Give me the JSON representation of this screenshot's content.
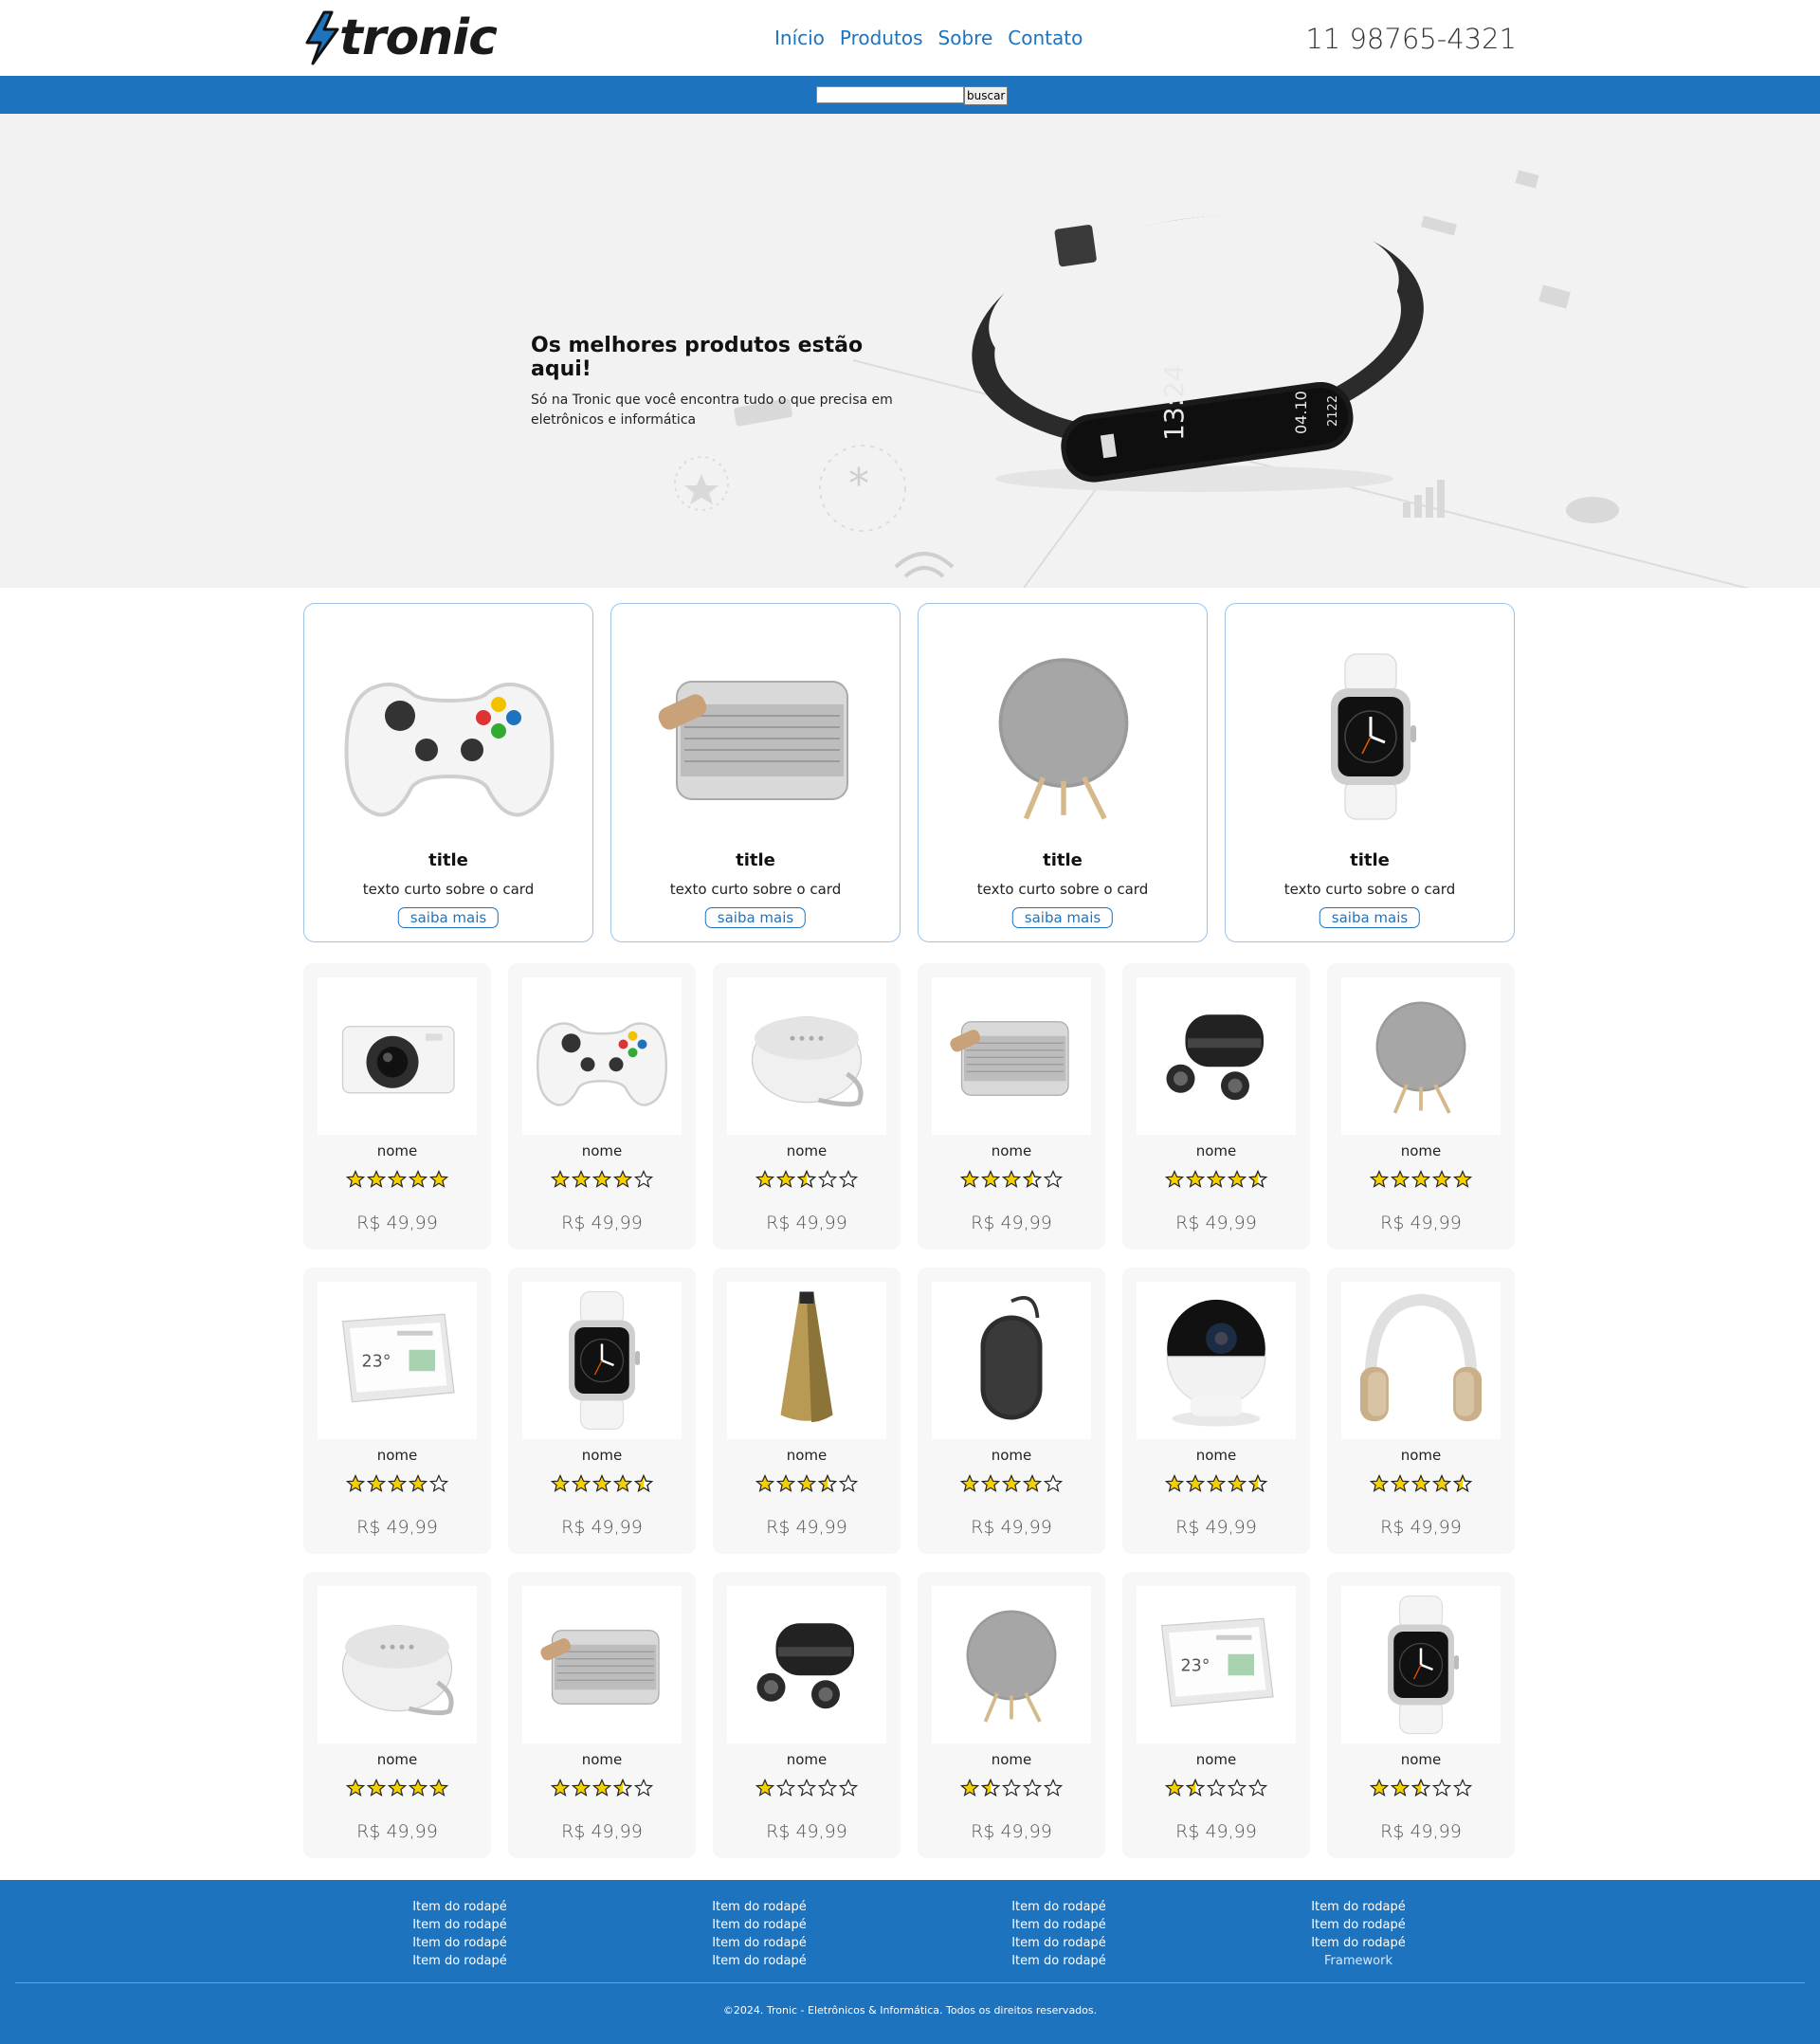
{
  "brand": {
    "name": "tronic",
    "accent_color": "#1e73be",
    "bolt_icon": "lightning-bolt-icon"
  },
  "nav": {
    "items": [
      "Início",
      "Produtos",
      "Sobre",
      "Contato"
    ]
  },
  "contact": {
    "phone": "11 98765-4321"
  },
  "search": {
    "placeholder": "",
    "value": "",
    "button_label": "buscar"
  },
  "hero": {
    "title": "Os melhores produtos estão aqui!",
    "subtitle": "Só na Tronic que você encontra tudo o que precisa em eletrônicos e informática",
    "watch_time": "13:24",
    "watch_date": "04.10",
    "watch_steps": "2122"
  },
  "featured": [
    {
      "image": "game-controller",
      "title": "title",
      "text": "texto curto sobre o card",
      "button": "saiba mais"
    },
    {
      "image": "portable-speaker",
      "title": "title",
      "text": "texto curto sobre o card",
      "button": "saiba mais"
    },
    {
      "image": "round-speaker",
      "title": "title",
      "text": "texto curto sobre o card",
      "button": "saiba mais"
    },
    {
      "image": "smartwatch",
      "title": "title",
      "text": "texto curto sobre o card",
      "button": "saiba mais"
    }
  ],
  "products": [
    {
      "image": "action-camera",
      "name": "nome",
      "rating": 5,
      "price": "R$ 49,99"
    },
    {
      "image": "game-controller",
      "name": "nome",
      "rating": 4,
      "price": "R$ 49,99"
    },
    {
      "image": "smart-speaker",
      "name": "nome",
      "rating": 2.5,
      "price": "R$ 49,99"
    },
    {
      "image": "portable-speaker",
      "name": "nome",
      "rating": 3.5,
      "price": "R$ 49,99"
    },
    {
      "image": "wireless-earbuds",
      "name": "nome",
      "rating": 4.5,
      "price": "R$ 49,99"
    },
    {
      "image": "round-speaker",
      "name": "nome",
      "rating": 5,
      "price": "R$ 49,99"
    },
    {
      "image": "smart-display",
      "name": "nome",
      "rating": 4,
      "price": "R$ 49,99"
    },
    {
      "image": "smartwatch",
      "name": "nome",
      "rating": 4.5,
      "price": "R$ 49,99"
    },
    {
      "image": "gold-speaker",
      "name": "nome",
      "rating": 3.5,
      "price": "R$ 49,99"
    },
    {
      "image": "pill-speaker",
      "name": "nome",
      "rating": 4,
      "price": "R$ 49,99"
    },
    {
      "image": "security-camera",
      "name": "nome",
      "rating": 4.5,
      "price": "R$ 49,99"
    },
    {
      "image": "headphones",
      "name": "nome",
      "rating": 4.5,
      "price": "R$ 49,99"
    },
    {
      "image": "smart-speaker",
      "name": "nome",
      "rating": 5,
      "price": "R$ 49,99"
    },
    {
      "image": "portable-speaker",
      "name": "nome",
      "rating": 3.5,
      "price": "R$ 49,99"
    },
    {
      "image": "wireless-earbuds",
      "name": "nome",
      "rating": 1,
      "price": "R$ 49,99"
    },
    {
      "image": "round-speaker",
      "name": "nome",
      "rating": 1.5,
      "price": "R$ 49,99"
    },
    {
      "image": "smart-display",
      "name": "nome",
      "rating": 1.5,
      "price": "R$ 49,99"
    },
    {
      "image": "smartwatch",
      "name": "nome",
      "rating": 2.5,
      "price": "R$ 49,99"
    }
  ],
  "footer": {
    "columns": [
      [
        "Item do rodapé",
        "Item do rodapé",
        "Item do rodapé",
        "Item do rodapé"
      ],
      [
        "Item do rodapé",
        "Item do rodapé",
        "Item do rodapé",
        "Item do rodapé"
      ],
      [
        "Item do rodapé",
        "Item do rodapé",
        "Item do rodapé",
        "Item do rodapé"
      ],
      [
        "Item do rodapé",
        "Item do rodapé",
        "Item do rodapé",
        "Framework"
      ]
    ],
    "copyright": "©2024. Tronic - Eletrônicos & Informática. Todos os direitos reservados."
  }
}
